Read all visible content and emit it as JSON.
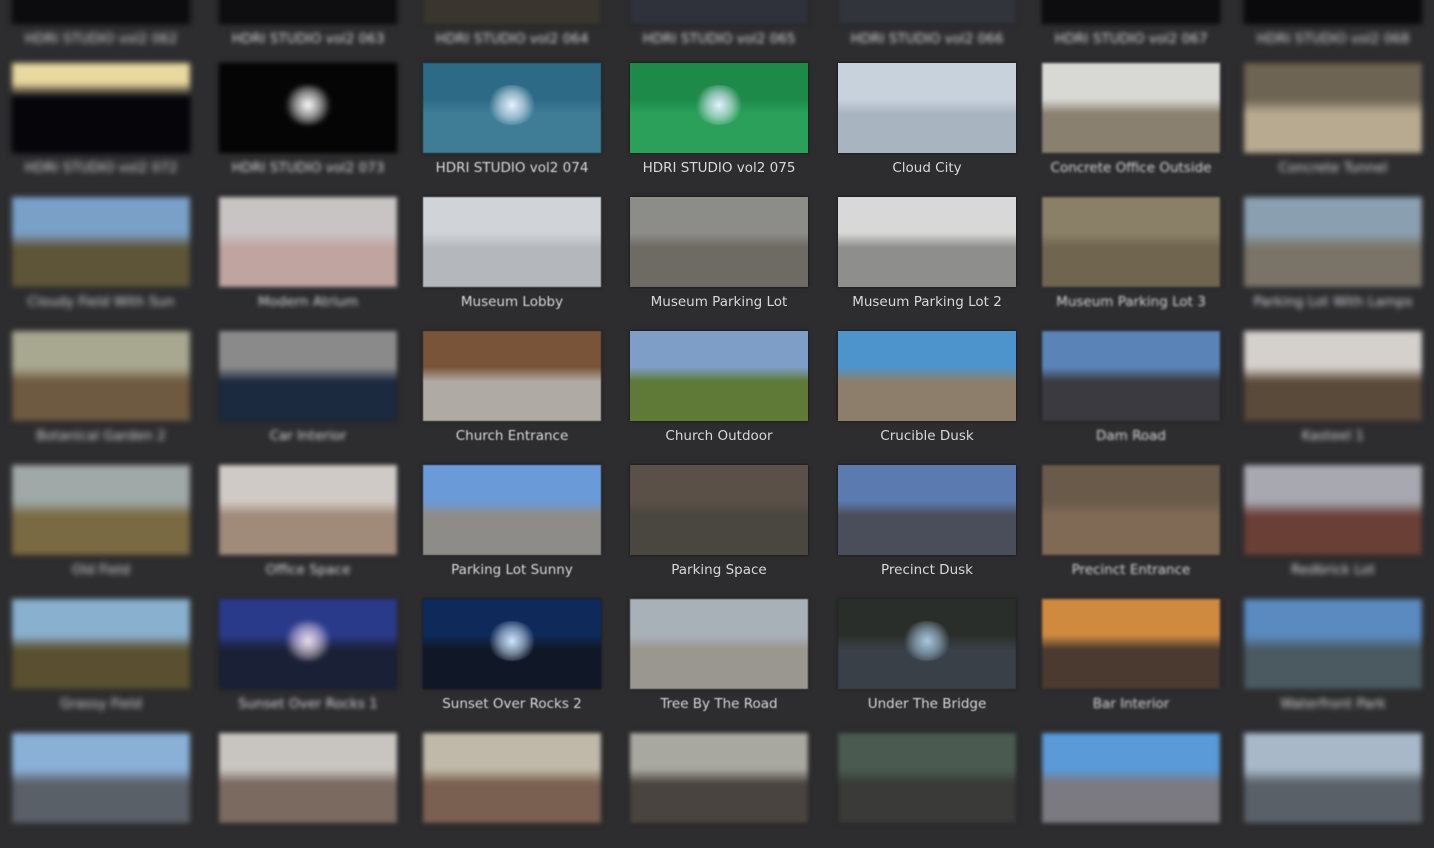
{
  "app": {
    "background": "#2d2d2f",
    "label_color": "#d8d8d8"
  },
  "grid": {
    "rows": [
      {
        "items": [
          {
            "label": "HDRI STUDIO vol2 062",
            "sky": "#141418",
            "ground": "#0c0c0e"
          },
          {
            "label": "HDRI STUDIO vol2 063",
            "sky": "#1a1a1c",
            "ground": "#0e0e10"
          },
          {
            "label": "HDRI STUDIO vol2 064",
            "sky": "#5a5448",
            "ground": "#3a362f"
          },
          {
            "label": "HDRI STUDIO vol2 065",
            "sky": "#4a4e58",
            "ground": "#2f323a"
          },
          {
            "label": "HDRI STUDIO vol2 066",
            "sky": "#4e525c",
            "ground": "#31343b"
          },
          {
            "label": "HDRI STUDIO vol2 067",
            "sky": "#151517",
            "ground": "#0d0d0f"
          },
          {
            "label": "HDRI STUDIO vol2 068",
            "sky": "#111113",
            "ground": "#0a0a0c"
          }
        ]
      },
      {
        "items": [
          {
            "label": "HDRI STUDIO vol2 072",
            "sky": "#e8d9a0",
            "ground": "#05050a",
            "split": 30
          },
          {
            "label": "HDRI STUDIO vol2 073",
            "sky": "#050505",
            "ground": "#050505",
            "spot": "#ffffff"
          },
          {
            "label": "HDRI STUDIO vol2 074",
            "sky": "#2c6a86",
            "ground": "#3f7d96",
            "spot": "#e6f2ff"
          },
          {
            "label": "HDRI STUDIO vol2 075",
            "sky": "#1e8a4a",
            "ground": "#2aa05a",
            "spot": "#e6f0ff"
          },
          {
            "label": "Cloud City",
            "sky": "#c8d2dc",
            "ground": "#a8b4c0"
          },
          {
            "label": "Concrete Office Outside",
            "sky": "#d8d8d4",
            "ground": "#8a8070"
          },
          {
            "label": "Concrete Tunnel",
            "sky": "#6e6454",
            "ground": "#b8aa90"
          }
        ]
      },
      {
        "items": [
          {
            "label": "Cloudy Field With Sun",
            "sky": "#7aa0c8",
            "ground": "#5e5538"
          },
          {
            "label": "Modern Atrium",
            "sky": "#c8c4c4",
            "ground": "#c0a4a0"
          },
          {
            "label": "Museum Lobby",
            "sky": "#d0d4d8",
            "ground": "#b4b8bc"
          },
          {
            "label": "Museum Parking Lot",
            "sky": "#8c8c88",
            "ground": "#6e6a64"
          },
          {
            "label": "Museum Parking Lot 2",
            "sky": "#d8d8d8",
            "ground": "#8e8e8c"
          },
          {
            "label": "Museum Parking Lot 3",
            "sky": "#8a8068",
            "ground": "#706650"
          },
          {
            "label": "Parking Lot With Lamps",
            "sky": "#8aa0b0",
            "ground": "#7a7468"
          }
        ]
      },
      {
        "items": [
          {
            "label": "Botanical Garden 2",
            "sky": "#a8a890",
            "ground": "#6e5a40"
          },
          {
            "label": "Car Interior",
            "sky": "#8a8a8a",
            "ground": "#1c2a40"
          },
          {
            "label": "Church Entrance",
            "sky": "#7a5438",
            "ground": "#b0aaa4"
          },
          {
            "label": "Church Outdoor",
            "sky": "#7e9ec8",
            "ground": "#5f7a36"
          },
          {
            "label": "Crucible Dusk",
            "sky": "#4e94cc",
            "ground": "#8c7e6a"
          },
          {
            "label": "Dam Road",
            "sky": "#5a84b8",
            "ground": "#3a3a40"
          },
          {
            "label": "Kasteel 1",
            "sky": "#d4d0cc",
            "ground": "#5a4a3a"
          }
        ]
      },
      {
        "items": [
          {
            "label": "Old Field",
            "sky": "#a0a8a8",
            "ground": "#7a6a44"
          },
          {
            "label": "Office Space",
            "sky": "#d0cac6",
            "ground": "#a08a7a"
          },
          {
            "label": "Parking Lot Sunny",
            "sky": "#6a9ad8",
            "ground": "#8e8c88"
          },
          {
            "label": "Parking Space",
            "sky": "#5a5048",
            "ground": "#4a4640"
          },
          {
            "label": "Precinct Dusk",
            "sky": "#5a7ab0",
            "ground": "#4a4e5a"
          },
          {
            "label": "Precinct Entrance",
            "sky": "#6a5a4a",
            "ground": "#806a56"
          },
          {
            "label": "Redbrick Lot",
            "sky": "#a8a8b0",
            "ground": "#6a4036"
          }
        ]
      },
      {
        "items": [
          {
            "label": "Grassy Field",
            "sky": "#8ab0d0",
            "ground": "#5a5030"
          },
          {
            "label": "Sunset Over Rocks 1",
            "sky": "#2a3a8a",
            "ground": "#1a2036",
            "spot": "#f0e0f0"
          },
          {
            "label": "Sunset Over Rocks 2",
            "sky": "#0e2a5a",
            "ground": "#101828",
            "spot": "#cfe6ff"
          },
          {
            "label": "Tree By The Road",
            "sky": "#a8b0b8",
            "ground": "#9a9690"
          },
          {
            "label": "Under The Bridge",
            "sky": "#2a2e2a",
            "ground": "#3a4048",
            "spot": "#a8c8e0"
          },
          {
            "label": "Bar Interior",
            "sky": "#d08a40",
            "ground": "#4a3a30"
          },
          {
            "label": "Waterfront Park",
            "sky": "#5a8ac0",
            "ground": "#4a5a60"
          }
        ]
      },
      {
        "items": [
          {
            "label": "",
            "sky": "#8ab0d8",
            "ground": "#5a6068"
          },
          {
            "label": "",
            "sky": "#c8c4c0",
            "ground": "#7a6a60"
          },
          {
            "label": "",
            "sky": "#c0b8a8",
            "ground": "#7a6050"
          },
          {
            "label": "",
            "sky": "#a8a8a0",
            "ground": "#4a4440"
          },
          {
            "label": "",
            "sky": "#4a5a50",
            "ground": "#3a3a38"
          },
          {
            "label": "",
            "sky": "#5a9ad8",
            "ground": "#7a7a80"
          },
          {
            "label": "",
            "sky": "#a8b8c8",
            "ground": "#5a6068"
          }
        ]
      }
    ]
  }
}
